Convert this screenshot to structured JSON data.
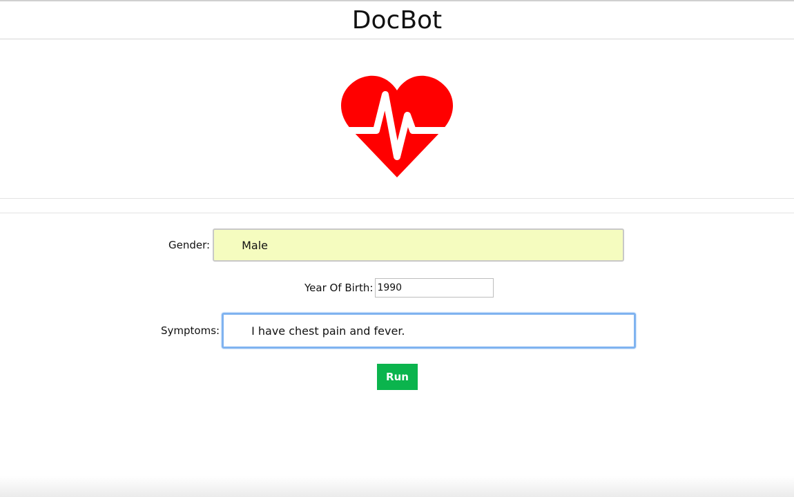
{
  "app": {
    "title": "DocBot"
  },
  "logo": {
    "icon": "heart-pulse-icon",
    "color": "#ff0000"
  },
  "form": {
    "gender_label": "Gender:",
    "gender_value": "Male",
    "year_label": "Year Of Birth:",
    "year_value": "1990",
    "symptoms_label": "Symptoms:",
    "symptoms_value": "I have chest pain and fever.",
    "run_label": "Run"
  },
  "colors": {
    "accent_green": "#0bb44d",
    "select_bg": "#f5fcbf",
    "focus_blue": "#7fb3f0"
  }
}
